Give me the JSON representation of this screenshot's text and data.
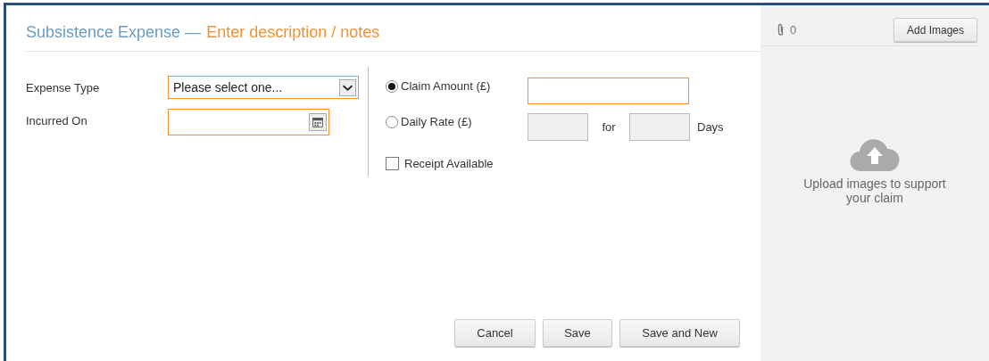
{
  "dialog": {
    "title": "Subsistence Expense —",
    "description_link": "Enter description / notes"
  },
  "form": {
    "expense_type": {
      "label": "Expense Type",
      "value": "Please select one..."
    },
    "incurred_on": {
      "label": "Incurred On"
    },
    "amount_options": [
      {
        "label": "Claim Amount (£)",
        "selected": true
      },
      {
        "label": "Daily Rate (£)",
        "selected": false
      }
    ],
    "daily_rate": {
      "for_label": "for",
      "days_label": "Days"
    },
    "receipt": {
      "label": "Receipt Available",
      "checked": false
    }
  },
  "buttons": [
    "Cancel",
    "Save",
    "Save and New"
  ],
  "attachments": {
    "count": "0",
    "add_button": "Add Images",
    "upload_hint": "Upload images to support your claim"
  }
}
